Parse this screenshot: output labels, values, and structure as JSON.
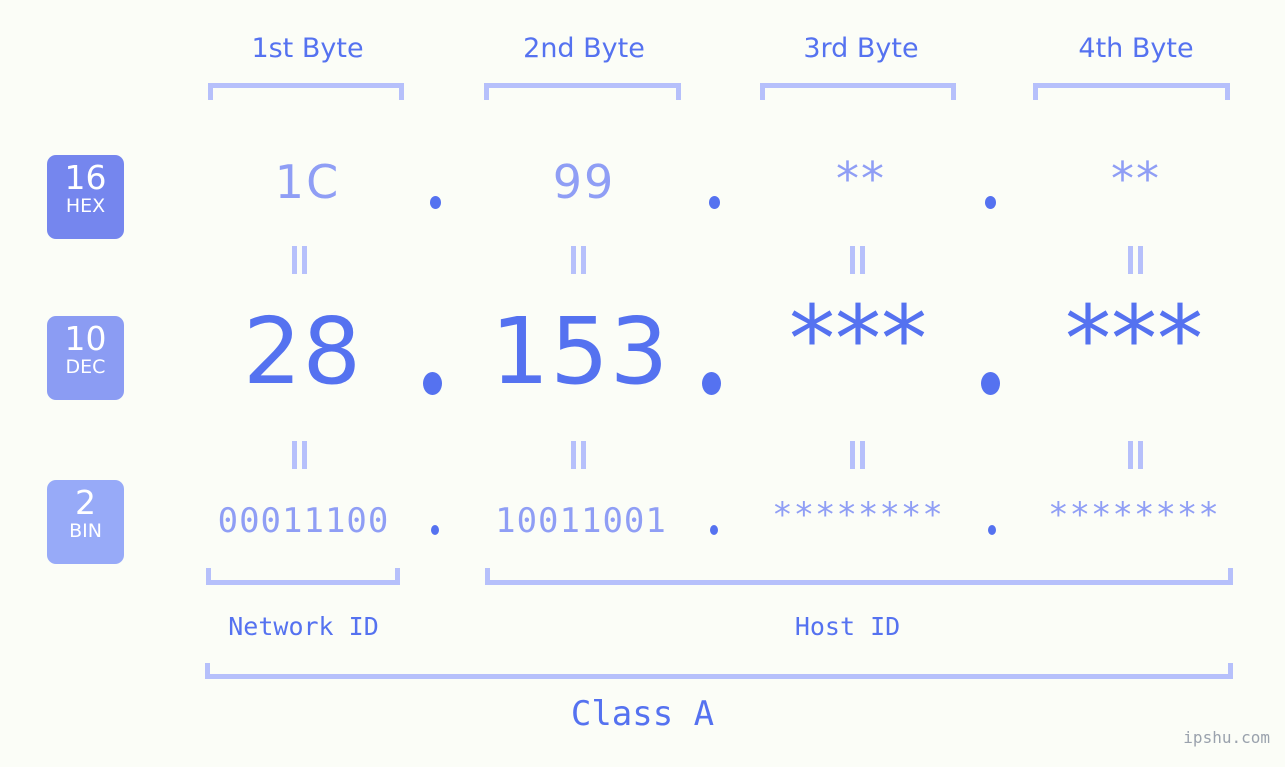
{
  "meta": {
    "background_color": "#fbfdf7",
    "accent_color": "#5572f0",
    "accent_light_color": "#8f9ef5",
    "bracket_color": "#b6c0fb",
    "watermark": "ipshu.com"
  },
  "byte_headers": [
    {
      "label": "1st Byte"
    },
    {
      "label": "2nd Byte"
    },
    {
      "label": "3rd Byte"
    },
    {
      "label": "4th Byte"
    }
  ],
  "bases": [
    {
      "number": "16",
      "abbr": "HEX",
      "color": "#7586ee"
    },
    {
      "number": "10",
      "abbr": "DEC",
      "color": "#8b9cf3"
    },
    {
      "number": "2",
      "abbr": "BIN",
      "color": "#97aaf8"
    }
  ],
  "rows": {
    "hex": {
      "base_number": "16",
      "base_abbr": "HEX",
      "values": [
        "1C",
        "99",
        "**",
        "**"
      ],
      "separator": "."
    },
    "dec": {
      "base_number": "10",
      "base_abbr": "DEC",
      "values": [
        "28",
        "153",
        "***",
        "***"
      ],
      "separator": "."
    },
    "bin": {
      "base_number": "2",
      "base_abbr": "BIN",
      "values": [
        "00011100",
        "10011001",
        "********",
        "********"
      ],
      "separator": "."
    }
  },
  "equals_marks": {
    "glyph": "||",
    "count_per_gap": 4
  },
  "id_spans": [
    {
      "label": "Network ID",
      "bytes": "1"
    },
    {
      "label": "Host ID",
      "bytes": "2-4"
    }
  ],
  "class_span": {
    "label": "Class A"
  }
}
